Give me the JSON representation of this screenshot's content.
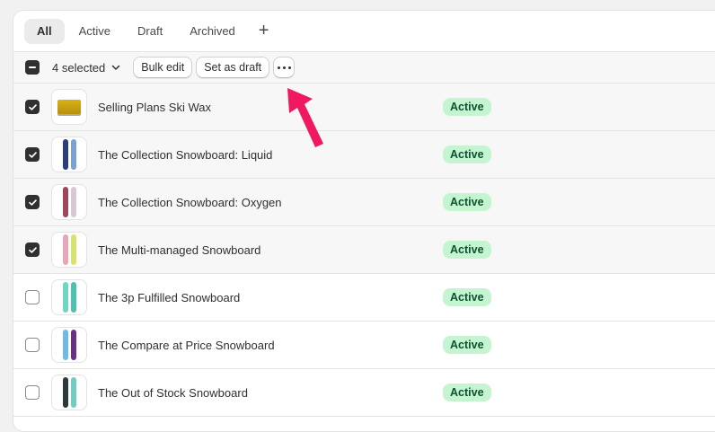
{
  "tabs": [
    {
      "label": "All",
      "active": true
    },
    {
      "label": "Active",
      "active": false
    },
    {
      "label": "Draft",
      "active": false
    },
    {
      "label": "Archived",
      "active": false
    }
  ],
  "tab_add_label": "+",
  "bulk": {
    "selected_label": "4 selected",
    "bulk_edit_label": "Bulk edit",
    "set_draft_label": "Set as draft"
  },
  "products": [
    {
      "name": "Selling Plans Ski Wax",
      "status": "Active",
      "checked": true,
      "thumb": "wax",
      "colors": []
    },
    {
      "name": "The Collection Snowboard: Liquid",
      "status": "Active",
      "checked": true,
      "thumb": "boards",
      "colors": [
        "#2d3d7a",
        "#7aa0d8"
      ]
    },
    {
      "name": "The Collection Snowboard: Oxygen",
      "status": "Active",
      "checked": true,
      "thumb": "boards",
      "colors": [
        "#a0465c",
        "#d8c7d4"
      ]
    },
    {
      "name": "The Multi-managed Snowboard",
      "status": "Active",
      "checked": true,
      "thumb": "boards",
      "colors": [
        "#e8a7b8",
        "#d9e36a"
      ]
    },
    {
      "name": "The 3p Fulfilled Snowboard",
      "status": "Active",
      "checked": false,
      "thumb": "boards",
      "colors": [
        "#6fd6c2",
        "#4cc2b0"
      ]
    },
    {
      "name": "The Compare at Price Snowboard",
      "status": "Active",
      "checked": false,
      "thumb": "boards",
      "colors": [
        "#74b8e6",
        "#6a2f8a"
      ]
    },
    {
      "name": "The Out of Stock Snowboard",
      "status": "Active",
      "checked": false,
      "thumb": "boards",
      "colors": [
        "#2b3a3a",
        "#6fcfbf"
      ]
    }
  ],
  "colors": {
    "badge_bg": "#c5f5d0",
    "badge_text": "#0c5132",
    "arrow": "#f0195f"
  }
}
